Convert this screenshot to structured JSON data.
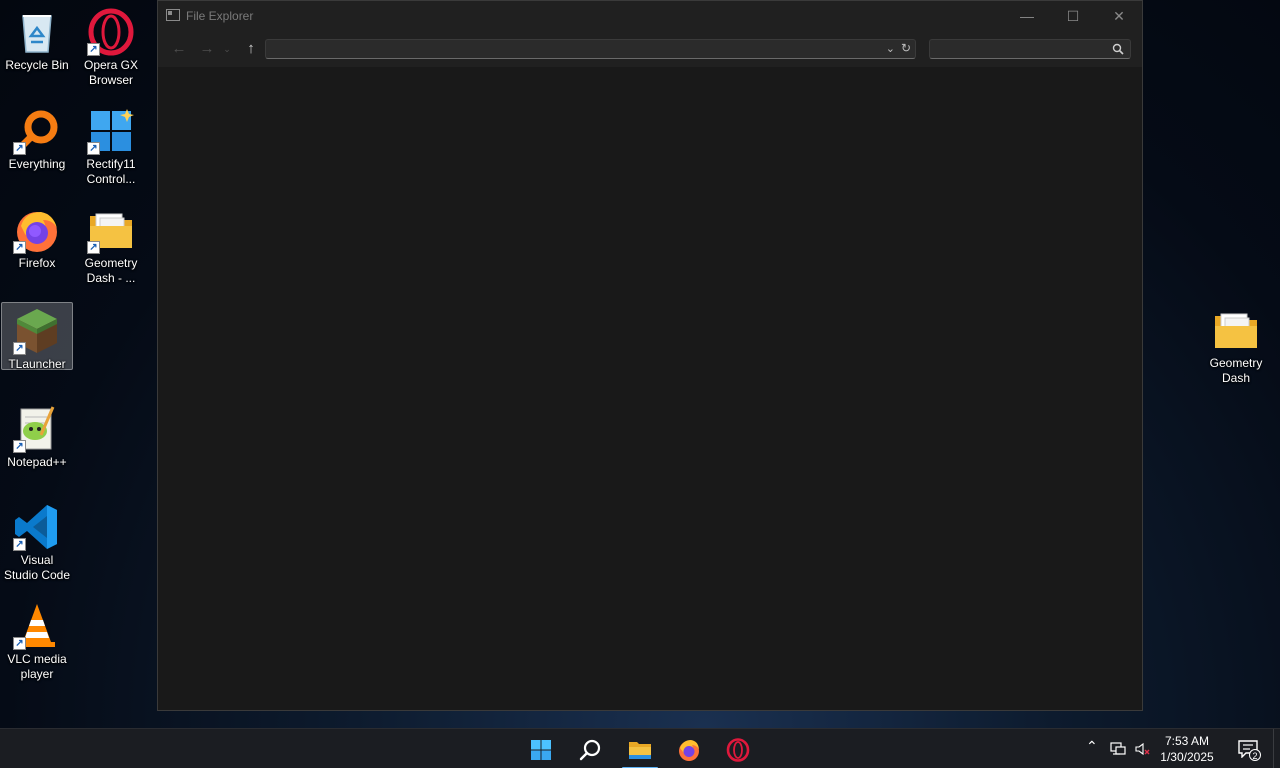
{
  "desktop": {
    "icons_left": [
      {
        "label_1": "Recycle Bin",
        "label_2": "",
        "icon": "recycle-bin-icon",
        "shortcut": false
      },
      {
        "label_1": "Opera GX",
        "label_2": "Browser",
        "icon": "opera-gx-icon",
        "shortcut": true
      },
      {
        "label_1": "Everything",
        "label_2": "",
        "icon": "everything-search-icon",
        "shortcut": true
      },
      {
        "label_1": "Rectify11",
        "label_2": "Control...",
        "icon": "rectify11-icon",
        "shortcut": true
      },
      {
        "label_1": "Firefox",
        "label_2": "",
        "icon": "firefox-icon",
        "shortcut": true
      },
      {
        "label_1": "Geometry",
        "label_2": "Dash - ...",
        "icon": "folder-icon",
        "shortcut": true
      },
      {
        "label_1": "TLauncher",
        "label_2": "",
        "icon": "tlauncher-grass-block-icon",
        "shortcut": true
      },
      {
        "label_1": "Notepad++",
        "label_2": "",
        "icon": "notepad-plus-plus-icon",
        "shortcut": true
      },
      {
        "label_1": "Visual",
        "label_2": "Studio Code",
        "icon": "vscode-icon",
        "shortcut": true
      },
      {
        "label_1": "VLC media",
        "label_2": "player",
        "icon": "vlc-icon",
        "shortcut": true
      }
    ],
    "icon_right": {
      "label_1": "Geometry",
      "label_2": "Dash",
      "icon": "folder-icon",
      "shortcut": false
    }
  },
  "window": {
    "title": "File Explorer",
    "minimize_glyph": "—",
    "maximize_glyph": "☐",
    "close_glyph": "✕",
    "back_glyph": "←",
    "forward_glyph": "→",
    "recent_glyph": "⌄",
    "up_glyph": "↑",
    "address_value": "",
    "search_placeholder": "",
    "address_dropdown_glyph": "⌄",
    "refresh_glyph": "↻"
  },
  "taskbar": {
    "pinned": [
      "start-icon",
      "search-icon",
      "file-explorer-icon",
      "firefox-icon",
      "opera-gx-icon"
    ],
    "active_app": "file-explorer-icon",
    "tray": {
      "overflow_glyph": "⌃",
      "time": "7:53 AM",
      "date": "1/30/2025",
      "notification_count": "2"
    }
  },
  "colors": {
    "window_bg": "#191919",
    "titlebar_bg": "#202020",
    "taskbar_bg": "#1b1d22",
    "accent": "#5fb3f5",
    "opera_red": "#e0183c",
    "folder_yellow": "#f5c242"
  }
}
